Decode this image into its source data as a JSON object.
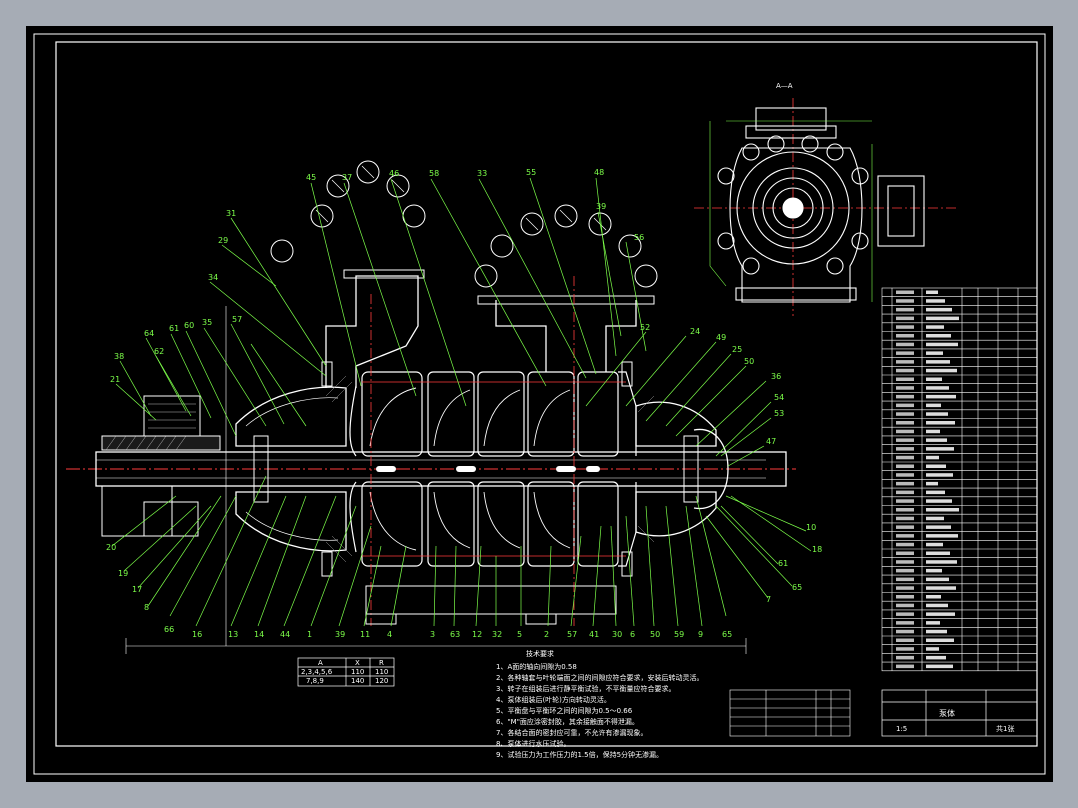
{
  "drawing": {
    "section_label": "A—A",
    "bubble_numbers_top": [
      "45",
      "37",
      "46",
      "58",
      "33",
      "55",
      "48",
      "39",
      "56"
    ],
    "bubble_numbers_left": [
      "31",
      "29",
      "34",
      "64",
      "62",
      "61",
      "60",
      "35",
      "57",
      "38",
      "21"
    ],
    "bubble_numbers_right": [
      "52",
      "24",
      "49",
      "25",
      "50",
      "36",
      "54",
      "53",
      "47"
    ],
    "bubble_numbers_bottom": [
      "16",
      "13",
      "14",
      "44",
      "1",
      "39",
      "11",
      "4",
      "3",
      "63",
      "12",
      "32",
      "5",
      "2",
      "57",
      "41",
      "30",
      "6",
      "50",
      "59",
      "9",
      "65"
    ],
    "bubble_numbers_side": [
      "20",
      "19",
      "17",
      "8",
      "66",
      "10",
      "18",
      "61",
      "65",
      "7"
    ],
    "spec_table": {
      "headers": [
        "A",
        "X",
        "R"
      ],
      "rows": [
        [
          "2,3,4,5,6",
          "110",
          "110"
        ],
        [
          "7,8,9",
          "140",
          "120"
        ]
      ]
    },
    "notes_title": "技术要求",
    "notes": [
      "1、A面的轴向间隙为0.58",
      "2、各种轴套与叶轮端面之间的间隙应符合要求，安装后转动灵活。",
      "3、转子在组装后进行静平衡试验，不平衡量应符合要求。",
      "4、泵体组装后(叶轮)方向转动灵活。",
      "5、平衡盘与平衡环之间的间隙为0.5～0.66",
      "6、\"M\"面应涂密封胶，其余接触面不得泄漏。",
      "7、各结合面的密封应可靠，不允许有渗漏现象。",
      "8、泵体进行水压试验。",
      "9、试验压力为工作压力的1.5倍，保持5分钟无渗漏。"
    ],
    "title_block": {
      "drawing_name": "泵体",
      "scale": "1:5",
      "sheet": "共1张"
    }
  },
  "colors": {
    "background": "#000000",
    "frame": "#ffffff",
    "leader": "#7dff4a",
    "outline": "#ffffff",
    "centerline": "#ff3b3b",
    "hatch": "#bfbfbf",
    "page_margin": "#a6acb5"
  }
}
